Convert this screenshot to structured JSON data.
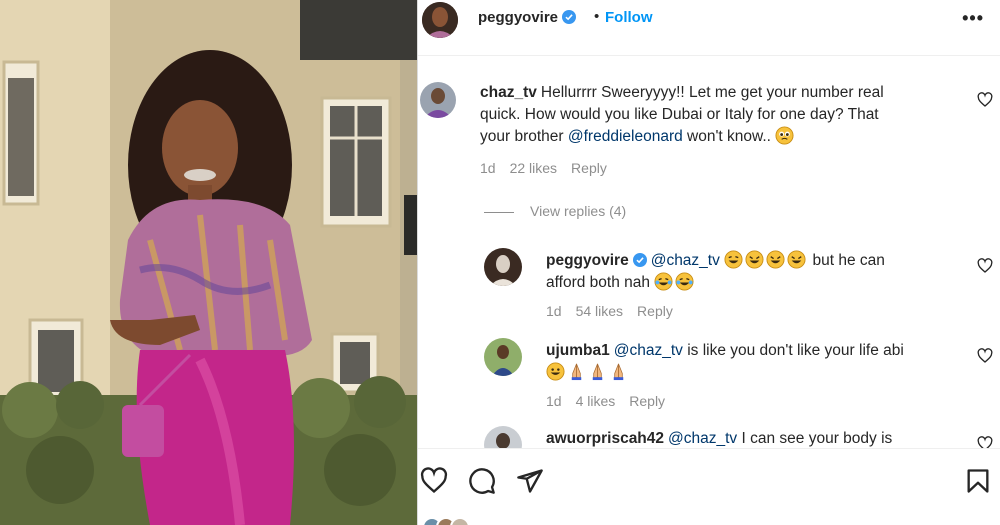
{
  "post": {
    "username": "peggyovire",
    "separator": "•",
    "follow_label": "Follow",
    "more_label": "•••"
  },
  "comments": [
    {
      "user": "chaz_tv",
      "text_1": "Hellurrrr Sweeryyyy!! Let me get your number real",
      "text_2": "quick. How would you like Dubai or Italy for one day? That",
      "text_3_pre": "your brother ",
      "mention": "@freddieleonard",
      "text_3_post": " won't know..",
      "time": "1d",
      "likes": "22 likes",
      "reply": "Reply"
    }
  ],
  "view_replies": "View replies (4)",
  "replies": [
    {
      "user": "peggyovire",
      "mention": "@chaz_tv",
      "text_1_post": " but he can",
      "text_2": "afford both nah",
      "time": "1d",
      "likes": "54 likes",
      "reply": "Reply"
    },
    {
      "user": "ujumba1",
      "mention": "@chaz_tv",
      "text_1_post": " is like you don't like your life abi",
      "time": "1d",
      "likes": "4 likes",
      "reply": "Reply"
    },
    {
      "user": "awuorpriscah42",
      "mention": "@chaz_tv",
      "text_1_post": " I can see your body is"
    }
  ],
  "icons": {
    "heart": "heart-icon",
    "comment": "comment-icon",
    "share": "share-icon",
    "save": "bookmark-icon",
    "verified": "verified-badge-icon"
  },
  "colors": {
    "accent": "#0095f6",
    "mention": "#00376b",
    "muted": "#8e8e8e"
  }
}
